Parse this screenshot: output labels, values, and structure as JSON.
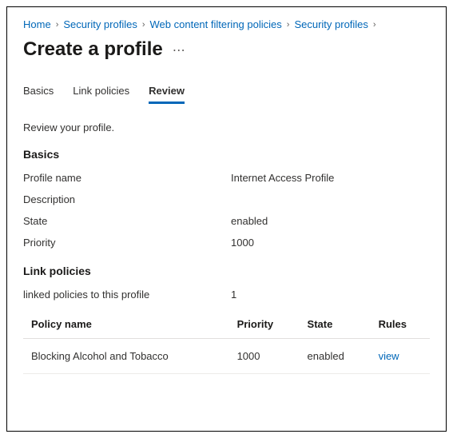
{
  "breadcrumb": {
    "items": [
      {
        "label": "Home"
      },
      {
        "label": "Security profiles"
      },
      {
        "label": "Web content filtering policies"
      },
      {
        "label": "Security profiles"
      }
    ],
    "sep": "›"
  },
  "header": {
    "title": "Create a profile",
    "more_icon": "⋯"
  },
  "tabs": [
    {
      "label": "Basics",
      "active": false
    },
    {
      "label": "Link policies",
      "active": false
    },
    {
      "label": "Review",
      "active": true
    }
  ],
  "review": {
    "helper": "Review your profile.",
    "basics_title": "Basics",
    "link_title": "Link policies",
    "fields": {
      "profile_name_label": "Profile name",
      "profile_name_value": "Internet Access Profile",
      "description_label": "Description",
      "description_value": "",
      "state_label": "State",
      "state_value": "enabled",
      "priority_label": "Priority",
      "priority_value": "1000"
    },
    "linked_label": "linked policies to this profile",
    "linked_count": "1",
    "table": {
      "headers": {
        "name": "Policy name",
        "priority": "Priority",
        "state": "State",
        "rules": "Rules"
      },
      "rows": [
        {
          "name": "Blocking Alcohol and Tobacco",
          "priority": "1000",
          "state": "enabled",
          "rules": "view"
        }
      ]
    }
  }
}
